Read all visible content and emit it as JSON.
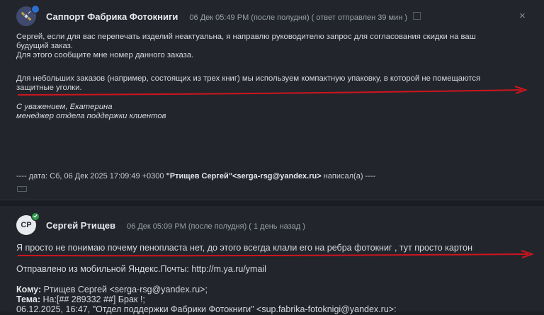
{
  "message1": {
    "sender": "Саппорт Фабрика Фотокниги",
    "meta": "06 Дек 05:49 PM (после полудня) ( ответ отправлен 39 мин )",
    "lines": [
      "Сергей, если для вас перепечать изделий неактуальна, я направлю руководителю запрос для согласования скидки на ваш",
      "будущий заказ.",
      "Для этого сообщите мне номер данного заказа.",
      "Для небольших заказов (например, состоящих из трех книг) мы используем компактную упаковку, в которой не помещаются",
      "защитные уголки."
    ],
    "signature": [
      "С уважением, Екатерина",
      "менеджер отдела поддержки клиентов"
    ],
    "quote_prefix": "---- дата: Сб, 06 Дек 2025 17:09:49 +0300 ",
    "quote_from": "\"Ртищев Сергей\"<serga-rsg@yandex.ru>",
    "quote_suffix": " написал(а) ----",
    "close_icon": "×"
  },
  "message2": {
    "avatar_initials": "СР",
    "sender": "Сергей Ртищев",
    "meta": "06 Дек 05:09 PM (после полудня) ( 1 день назад )",
    "body": "Я просто не понимаю почему пенопласта нет, до этого всегда клали его на ребра фотокниг , тут просто картон",
    "mobile": "Отправлено из мобильной Яндекс.Почты: http://m.ya.ru/ymail",
    "to_label": "Кому:",
    "to_value": " Ртищев Сергей <serga-rsg@yandex.ru>;",
    "subject_label": "Тема:",
    "subject_value": " На:[## 289332 ##] Брак !;",
    "partial_line": "06.12.2025, 16:47, \"Отдел поддержки Фабрики Фотокниги\" <sup.fabrika-fotoknigi@yandex.ru>:"
  },
  "colors": {
    "background": "#1d2025",
    "annotation_arrow": "#d0141e",
    "badge_blue": "#2d6fd1",
    "badge_green": "#2f9a4a"
  }
}
